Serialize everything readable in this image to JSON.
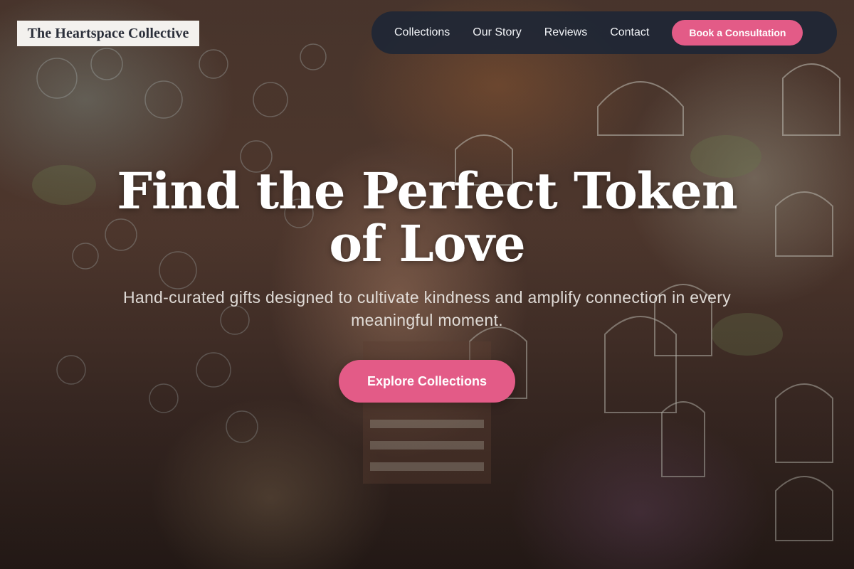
{
  "brand": {
    "name": "The Heartspace Collective"
  },
  "nav": {
    "links": [
      "Collections",
      "Our Story",
      "Reviews",
      "Contact"
    ],
    "cta_label": "Book a Consultation"
  },
  "hero": {
    "title": "Find the Perfect Token of Love",
    "subtitle": "Hand-curated gifts designed to cultivate kindness and amplify connection in every meaningful moment.",
    "cta_label": "Explore Collections",
    "background_image": "shop-interior-birdcages-photo"
  },
  "colors": {
    "accent": "#e35b87",
    "nav_background": "#1c2636",
    "logo_background": "#f3f1ee",
    "logo_text": "#2b2f3a"
  }
}
